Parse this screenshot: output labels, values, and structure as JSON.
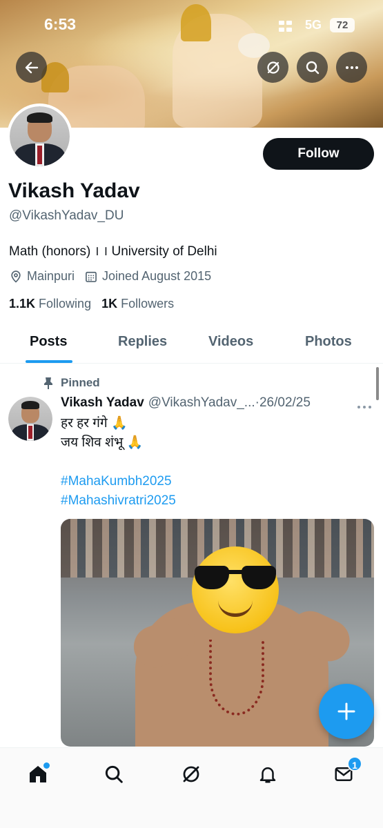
{
  "status_bar": {
    "time": "6:53",
    "network": "5G",
    "battery": "72"
  },
  "header": {
    "icons": [
      "back-arrow-icon",
      "grok-icon",
      "search-icon",
      "more-icon"
    ]
  },
  "profile": {
    "display_name": "Vikash Yadav",
    "handle": "@VikashYadav_DU",
    "bio": "Math (honors) । । University of Delhi",
    "location": "Mainpuri",
    "joined": "Joined August 2015",
    "following_count": "1.1K",
    "following_label": "Following",
    "followers_count": "1K",
    "followers_label": "Followers",
    "follow_button": "Follow"
  },
  "tabs": [
    {
      "label": "Posts",
      "active": true
    },
    {
      "label": "Replies",
      "active": false
    },
    {
      "label": "Videos",
      "active": false
    },
    {
      "label": "Photos",
      "active": false
    }
  ],
  "post": {
    "pinned_label": "Pinned",
    "author_name": "Vikash Yadav",
    "author_handle": "@VikashYadav_...",
    "date": "·26/02/25",
    "text_line1": "हर हर गंगे 🙏",
    "text_line2": "जय शिव शंभू 🙏",
    "hashtag1": "#MahaKumbh2025",
    "hashtag2": "#Mahashivratri2025"
  },
  "bottom_nav": {
    "items": [
      "home-icon",
      "search-icon",
      "grok-icon",
      "notifications-icon",
      "messages-icon"
    ],
    "messages_badge": "1"
  },
  "colors": {
    "accent": "#1d9bf0",
    "text_primary": "#0f1419",
    "text_secondary": "#536471",
    "follow_bg": "#0f1419"
  }
}
